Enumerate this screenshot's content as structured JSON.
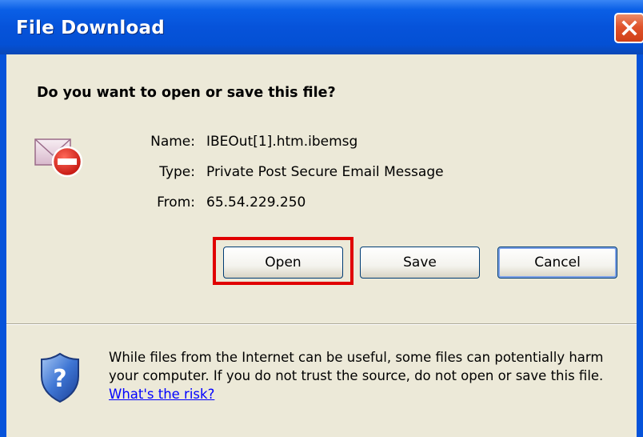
{
  "dialog": {
    "title": "File Download",
    "question": "Do you want to open or save this file?",
    "file": {
      "name_label": "Name:",
      "name_value": "IBEOut[1].htm.ibemsg",
      "type_label": "Type:",
      "type_value": "Private Post Secure Email Message",
      "from_label": "From:",
      "from_value": "65.54.229.250"
    },
    "buttons": {
      "open": "Open",
      "save": "Save",
      "cancel": "Cancel"
    },
    "warning": {
      "text": "While files from the Internet can be useful, some files can potentially harm your computer. If you do not trust the source, do not open or save this file.",
      "link": "What's the risk?"
    }
  },
  "icons": {
    "file": "blocked-envelope-icon",
    "warning": "security-shield-icon",
    "close": "close-icon"
  },
  "colors": {
    "titlebar": "#0653da",
    "dialog_bg": "#ece9d8",
    "close": "#e0532b",
    "highlight": "#e00000",
    "link": "#0000ff"
  }
}
